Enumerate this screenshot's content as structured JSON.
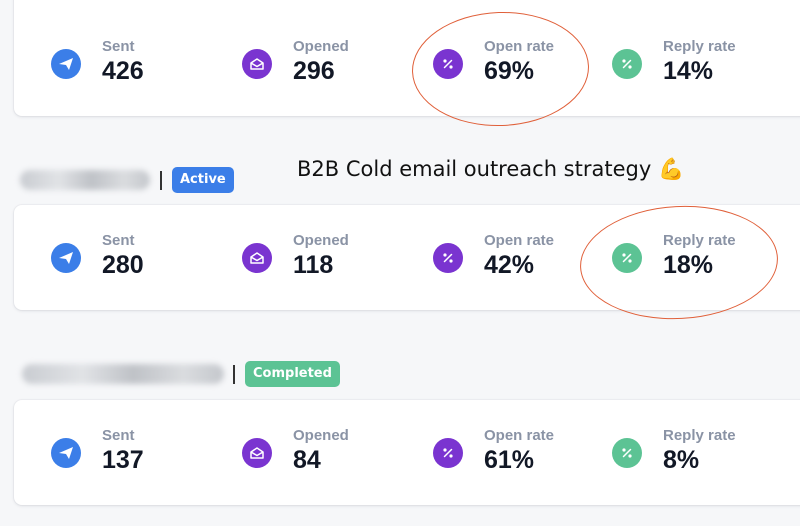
{
  "campaigns": [
    {
      "stats": {
        "sent": {
          "label": "Sent",
          "value": "426"
        },
        "opened": {
          "label": "Opened",
          "value": "296"
        },
        "open_rate": {
          "label": "Open rate",
          "value": "69%"
        },
        "reply_rate": {
          "label": "Reply rate",
          "value": "14%"
        }
      }
    },
    {
      "status": "Active",
      "stats": {
        "sent": {
          "label": "Sent",
          "value": "280"
        },
        "opened": {
          "label": "Opened",
          "value": "118"
        },
        "open_rate": {
          "label": "Open rate",
          "value": "42%"
        },
        "reply_rate": {
          "label": "Reply rate",
          "value": "18%"
        }
      }
    },
    {
      "status": "Completed",
      "stats": {
        "sent": {
          "label": "Sent",
          "value": "137"
        },
        "opened": {
          "label": "Opened",
          "value": "84"
        },
        "open_rate": {
          "label": "Open rate",
          "value": "61%"
        },
        "reply_rate": {
          "label": "Reply rate",
          "value": "8%"
        }
      }
    }
  ],
  "annotation": {
    "text": "B2B Cold email outreach strategy 💪"
  },
  "icons": {
    "sent": "send-icon",
    "opened": "open-envelope-icon",
    "open_rate": "percent-icon",
    "reply_rate": "percent-icon"
  },
  "colors": {
    "sent": "#3b7ee8",
    "opened": "#7a34d0",
    "open_rate": "#7a34d0",
    "reply_rate": "#5cc394",
    "active_badge": "#3b7ee8",
    "completed_badge": "#5cc394",
    "highlight": "#e0603a"
  }
}
